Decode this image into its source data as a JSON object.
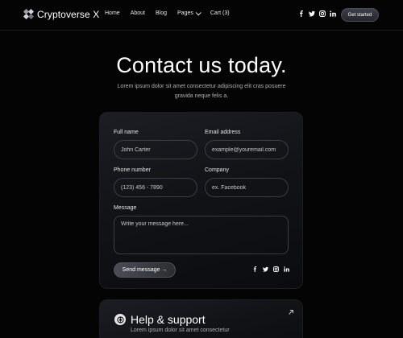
{
  "brand": {
    "name": "Cryptoverse X"
  },
  "nav": {
    "items": [
      "Home",
      "About",
      "Blog",
      "Pages",
      "Cart (3)"
    ],
    "cta_label": "Get started"
  },
  "hero": {
    "title": "Contact us today.",
    "subtitle": "Lorem ipsum dolor sit amet consectetur adipiscing elit cras posuere gravida neque felis a."
  },
  "form": {
    "full_name": {
      "label": "Full name",
      "placeholder": "John Carter"
    },
    "email": {
      "label": "Email address",
      "placeholder": "example@youremail.com"
    },
    "phone": {
      "label": "Phone number",
      "placeholder": "(123) 456 - 7890"
    },
    "company": {
      "label": "Company",
      "placeholder": "ex. Facebook"
    },
    "message": {
      "label": "Message",
      "placeholder": "Write your message here..."
    },
    "submit_label": "Send message →"
  },
  "social_icons": [
    "facebook-icon",
    "twitter-icon",
    "instagram-icon",
    "linkedin-icon"
  ],
  "help": {
    "title": "Help & support",
    "text": "Lorem ipsum dolor sit amet consectetur"
  },
  "colors": {
    "background": "#040404",
    "card": "#15171c",
    "border": "#3a3d44",
    "text": "#ffffff",
    "muted": "#b0b0b0"
  }
}
